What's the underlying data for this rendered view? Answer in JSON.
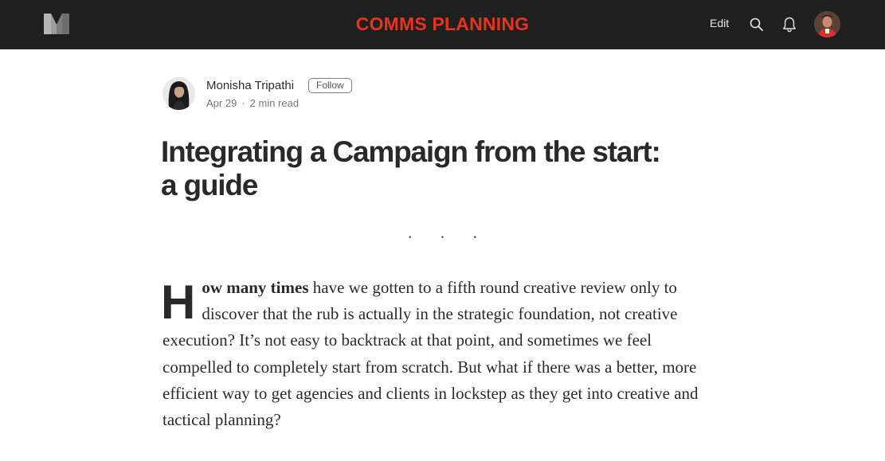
{
  "header": {
    "publication_name": "COMMS PLANNING",
    "edit_label": "Edit",
    "logo_icon": "medium-logo-icon",
    "search_icon": "search-icon",
    "bell_icon": "bell-icon",
    "accent_color": "#e8341c",
    "background_color": "#1f1f1f"
  },
  "author": {
    "name": "Monisha Tripathi",
    "follow_label": "Follow",
    "date": "Apr 29",
    "separator": "·",
    "read_time": "2 min read"
  },
  "article": {
    "title_line1": "Integrating a Campaign from the start:",
    "title_line2": "a guide",
    "section_separator": "· · ·",
    "drop_cap": "H",
    "lead_bold": "ow many times",
    "lead_rest": " have we gotten to a fifth round creative review only to discover that the rub is actually in the strategic foundation, not creative execution? It’s not easy to backtrack at that point, and sometimes we feel compelled to completely start from scratch. But what if there was a better, more efficient way to get agencies and clients in lockstep as they get into creative and tactical planning?"
  }
}
